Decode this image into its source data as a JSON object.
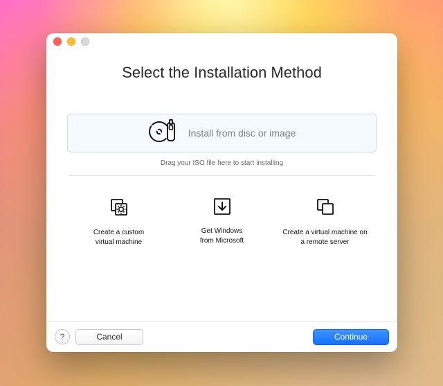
{
  "window": {
    "title": "Select the Installation Method"
  },
  "primary_option": {
    "label": "Install from disc or image",
    "hint": "Drag your ISO file here to start installing"
  },
  "secondary": [
    {
      "label": "Create a custom\nvirtual machine"
    },
    {
      "label": "Get Windows\nfrom Microsoft"
    },
    {
      "label": "Create a virtual machine on\na remote server"
    }
  ],
  "footer": {
    "help": "?",
    "cancel": "Cancel",
    "continue": "Continue"
  }
}
